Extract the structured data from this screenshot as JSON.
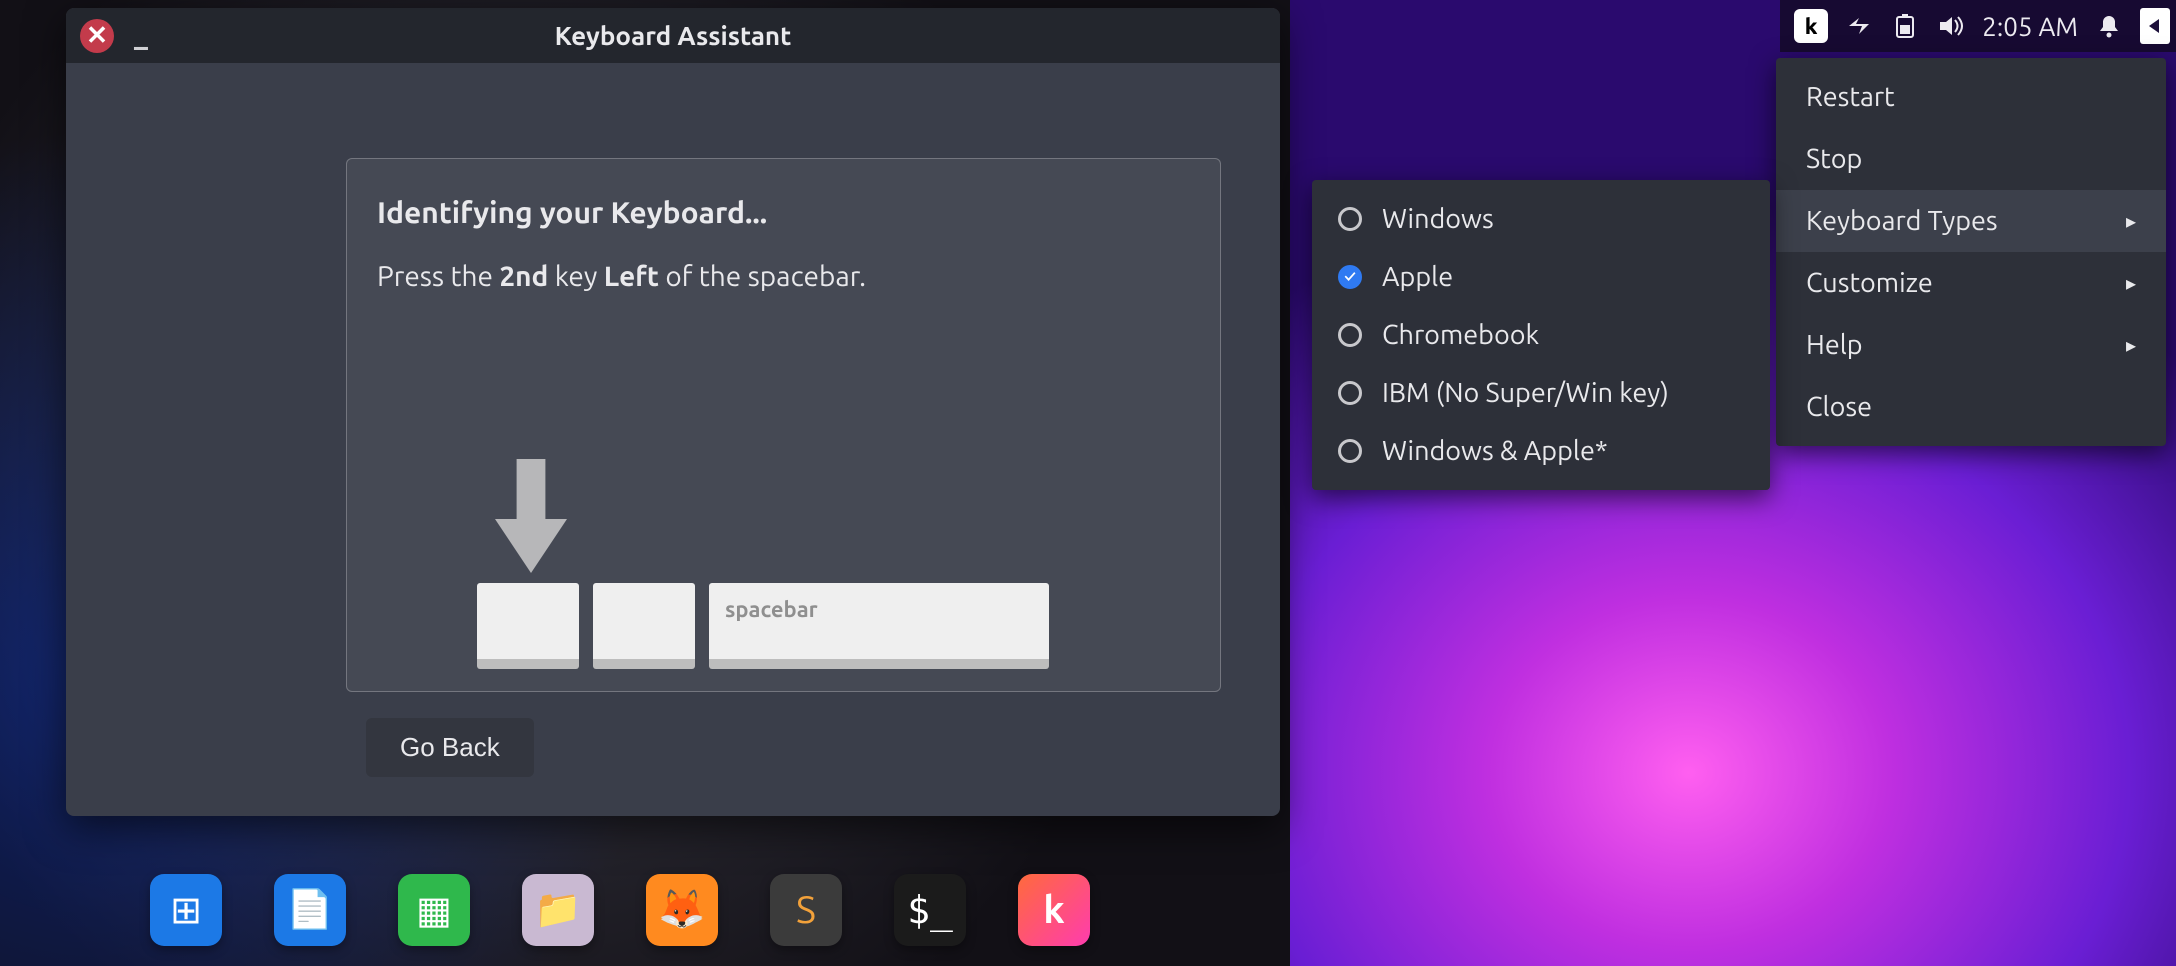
{
  "assistant": {
    "title": "Keyboard Assistant",
    "heading": "Identifying your Keyboard...",
    "instruction_pre": "Press the ",
    "instruction_b1": "2nd",
    "instruction_mid": " key ",
    "instruction_b2": "Left",
    "instruction_post": " of the spacebar.",
    "spacebar_label": "spacebar",
    "go_back": "Go Back"
  },
  "dock": {
    "items": [
      {
        "name": "app-menu",
        "glyph": "⊞"
      },
      {
        "name": "writer",
        "glyph": "📄"
      },
      {
        "name": "calc",
        "glyph": "▦"
      },
      {
        "name": "files",
        "glyph": "📁"
      },
      {
        "name": "firefox",
        "glyph": "🦊"
      },
      {
        "name": "sublime",
        "glyph": "S"
      },
      {
        "name": "terminal",
        "glyph": "$_"
      },
      {
        "name": "kinto",
        "glyph": "k"
      }
    ]
  },
  "topbar": {
    "kinto_glyph": "k",
    "time": "2:05 AM"
  },
  "tray_menu": {
    "items": [
      {
        "label": "Restart",
        "has_sub": false,
        "hover": false
      },
      {
        "label": "Stop",
        "has_sub": false,
        "hover": false
      },
      {
        "label": "Keyboard Types",
        "has_sub": true,
        "hover": true
      },
      {
        "label": "Customize",
        "has_sub": true,
        "hover": false
      },
      {
        "label": "Help",
        "has_sub": true,
        "hover": false
      },
      {
        "label": "Close",
        "has_sub": false,
        "hover": false
      }
    ]
  },
  "kbd_types": {
    "options": [
      {
        "label": "Windows",
        "checked": false
      },
      {
        "label": "Apple",
        "checked": true
      },
      {
        "label": "Chromebook",
        "checked": false
      },
      {
        "label": "IBM (No Super/Win key)",
        "checked": false
      },
      {
        "label": "Windows & Apple*",
        "checked": false
      }
    ]
  }
}
